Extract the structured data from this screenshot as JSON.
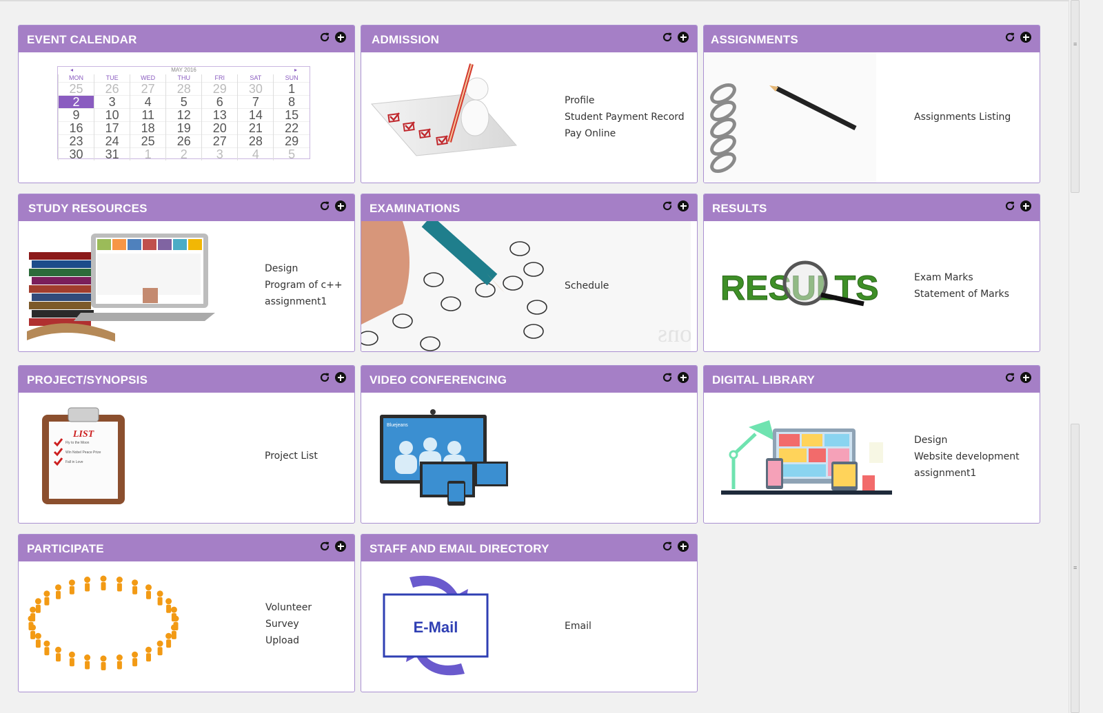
{
  "panels": {
    "event_calendar": {
      "title": "EVENT CALENDAR",
      "calendar": {
        "month_label": "MAY 2016",
        "prev": "◂",
        "next": "▸",
        "weekdays": [
          "MON",
          "TUE",
          "WED",
          "THU",
          "FRI",
          "SAT",
          "SUN"
        ],
        "weeks": [
          [
            "25",
            "26",
            "27",
            "28",
            "29",
            "30",
            "1"
          ],
          [
            "2",
            "3",
            "4",
            "5",
            "6",
            "7",
            "8"
          ],
          [
            "9",
            "10",
            "11",
            "12",
            "13",
            "14",
            "15"
          ],
          [
            "16",
            "17",
            "18",
            "19",
            "20",
            "21",
            "22"
          ],
          [
            "23",
            "24",
            "25",
            "26",
            "27",
            "28",
            "29"
          ],
          [
            "30",
            "31",
            "1",
            "2",
            "3",
            "4",
            "5"
          ]
        ],
        "selected_day": "2"
      }
    },
    "admission": {
      "title": "ADMISSION",
      "links": [
        "Profile",
        "Student Payment Record",
        "Pay Online"
      ]
    },
    "assignments": {
      "title": "ASSIGNMENTS",
      "links": [
        "Assignments Listing"
      ]
    },
    "study_resources": {
      "title": "STUDY RESOURCES",
      "links": [
        "Design",
        "Program of c++",
        "assignment1"
      ]
    },
    "examinations": {
      "title": "EXAMINATIONS",
      "links": [
        "Schedule"
      ],
      "watermark": "Examinations"
    },
    "results": {
      "title": "RESULTS",
      "links": [
        "Exam Marks",
        "Statement of Marks"
      ],
      "logo_text": "RESULTS"
    },
    "project_synopsis": {
      "title": "PROJECT/SYNOPSIS",
      "links": [
        "Project List"
      ],
      "clipboard_text": "LIST",
      "clipboard_items": [
        "Fly to the Moon",
        "Win Nobel Peace Prize",
        "Fall in Love"
      ]
    },
    "video_conferencing": {
      "title": "VIDEO CONFERENCING",
      "links": [],
      "screen_label": "Bluejeans"
    },
    "digital_library": {
      "title": "DIGITAL LIBRARY",
      "links": [
        "Design",
        "Website development",
        "assignment1"
      ]
    },
    "participate": {
      "title": "PARTICIPATE",
      "links": [
        "Volunteer",
        "Survey",
        "Upload"
      ]
    },
    "staff_email_directory": {
      "title": "STAFF AND EMAIL DIRECTORY",
      "links": [
        "Email"
      ],
      "email_logo": "E-Mail"
    }
  },
  "colors": {
    "header": "#a57fc6",
    "border": "#a98fd1",
    "accent": "#8a5cc0"
  },
  "icons": {
    "refresh": "refresh-icon",
    "add": "plus-circle-icon"
  }
}
